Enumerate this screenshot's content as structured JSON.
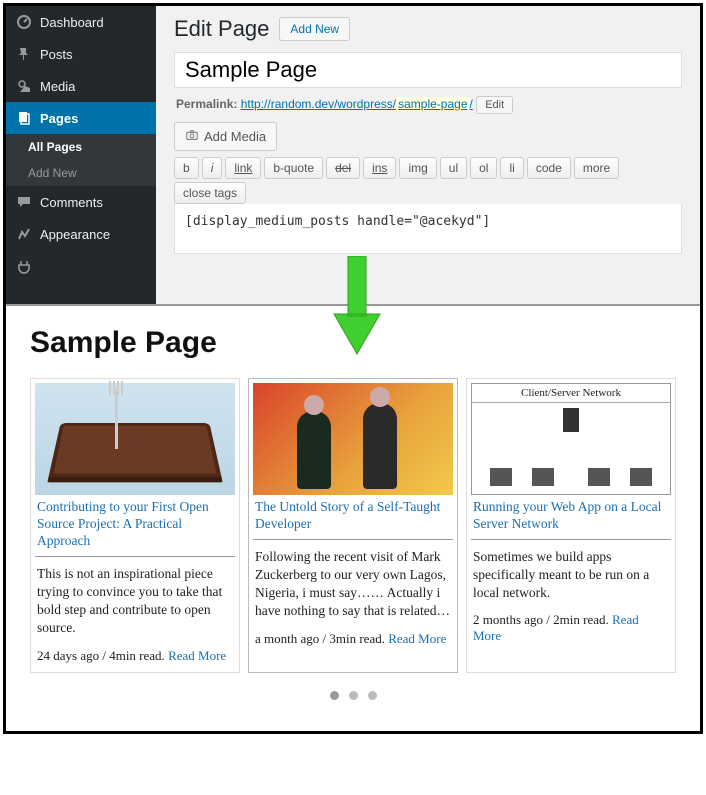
{
  "wp": {
    "sidebar": {
      "dashboard": "Dashboard",
      "posts": "Posts",
      "media": "Media",
      "pages": "Pages",
      "all_pages": "All Pages",
      "add_new": "Add New",
      "comments": "Comments",
      "appearance": "Appearance"
    },
    "heading": "Edit Page",
    "add_new_btn": "Add New",
    "title_value": "Sample Page",
    "permalink_label": "Permalink:",
    "permalink_base": "http://random.dev/wordpress/",
    "permalink_slug": "sample-page",
    "permalink_edit": "Edit",
    "add_media": "Add Media",
    "quicktags": [
      "b",
      "i",
      "link",
      "b-quote",
      "del",
      "ins",
      "img",
      "ul",
      "ol",
      "li",
      "code",
      "more",
      "close tags"
    ],
    "content": "[display_medium_posts handle=\"@acekyd\"]"
  },
  "front": {
    "title": "Sample Page",
    "cards": [
      {
        "title": "Contributing to your First Open Source Project: A Practical Approach",
        "excerpt": "This is not an inspirational piece trying to convince you to take that bold step and contribute to open source.",
        "meta": "24 days ago / 4min read.",
        "read_more": "Read More"
      },
      {
        "title": "The Untold Story of a Self-Taught Developer",
        "excerpt": "Following the recent visit of Mark Zuckerberg to our very own Lagos, Nigeria, i must say…… Actually i have nothing to say that is related…",
        "meta": "a month ago / 3min read.",
        "read_more": "Read More"
      },
      {
        "title": "Running your Web App on a Local Server Network",
        "thumb_label": "Client/Server Network",
        "excerpt": "Sometimes we build apps specifically meant to be run on a local network.",
        "meta": "2 months ago / 2min read.",
        "read_more": "Read More"
      }
    ]
  }
}
